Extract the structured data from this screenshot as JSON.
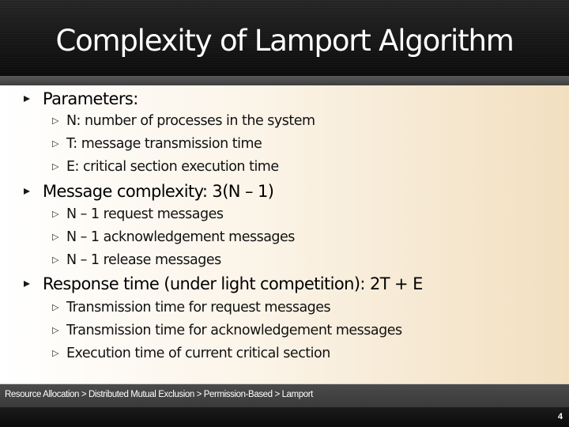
{
  "slide": {
    "title": "Complexity of Lamport Algorithm",
    "bullets": [
      {
        "text": "Parameters:",
        "children": [
          "N: number of processes in the system",
          "T: message transmission time",
          "E: critical section execution time"
        ]
      },
      {
        "text": "Message complexity: 3(N – 1)",
        "children": [
          "N – 1 request messages",
          "N – 1 acknowledgement messages",
          "N – 1 release messages"
        ]
      },
      {
        "text": "Response time (under light competition): 2T + E",
        "children": [
          "Transmission time for request messages",
          "Transmission time for acknowledgement messages",
          "Execution time of current critical section"
        ]
      }
    ]
  },
  "footer": {
    "breadcrumb": "Resource Allocation > Distributed Mutual Exclusion > Permission-Based > Lamport",
    "page_number": "4"
  },
  "icons": {
    "level1_bullet": "filled-triangle-right-icon",
    "level2_bullet": "outline-triangle-right-icon",
    "level2_glyph": "▷"
  }
}
